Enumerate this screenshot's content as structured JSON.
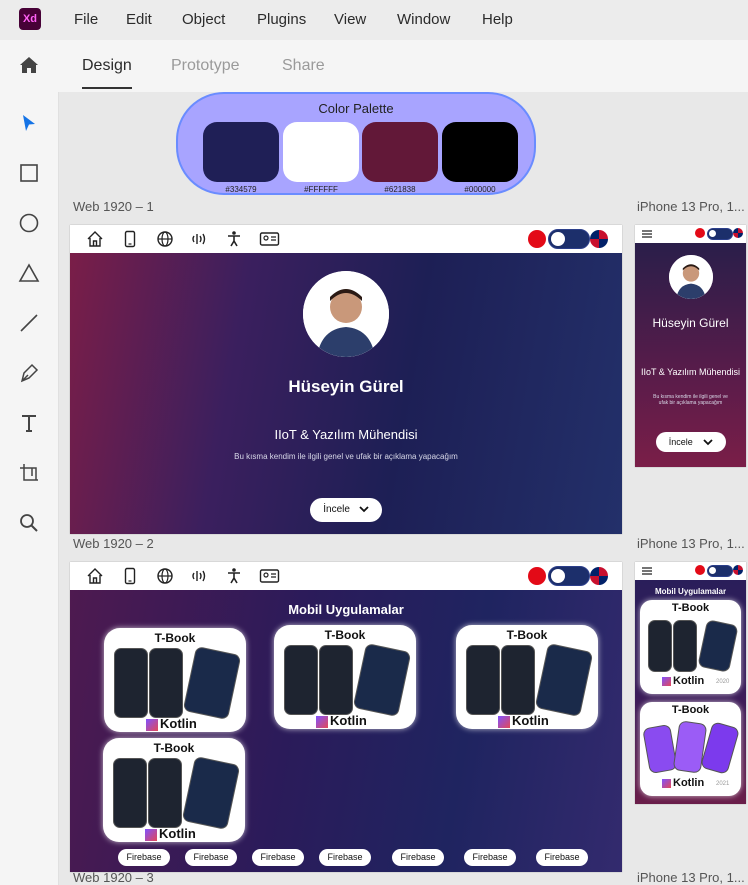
{
  "app": {
    "logo_text": "Xd"
  },
  "menu": [
    "File",
    "Edit",
    "Object",
    "Plugins",
    "View",
    "Window",
    "Help"
  ],
  "tabs": [
    "Design",
    "Prototype",
    "Share"
  ],
  "active_tab": "Design",
  "tools": [
    "select-icon",
    "rectangle-icon",
    "ellipse-icon",
    "polygon-icon",
    "line-icon",
    "pen-icon",
    "text-icon",
    "artboard-icon",
    "zoom-icon"
  ],
  "palette": {
    "title": "Color Palette",
    "colors": [
      {
        "hex": "#334579",
        "label": "#334579",
        "swatch": "#1f1f56"
      },
      {
        "hex": "#FFFFFF",
        "label": "#FFFFFF",
        "swatch": "#ffffff"
      },
      {
        "hex": "#621838",
        "label": "#621838",
        "swatch": "#621838"
      },
      {
        "hex": "#000000",
        "label": "#000000",
        "swatch": "#000000"
      }
    ]
  },
  "artboards": {
    "web1_label": "Web 1920 – 1",
    "web2_label": "Web 1920 – 2",
    "web3_label": "Web 1920 – 3",
    "iphone1_label": "iPhone 13 Pro, 1...",
    "iphone2_label": "iPhone 13 Pro, 1...",
    "iphone3_label": "iPhone 13 Pro, 1..."
  },
  "hero": {
    "name": "Hüseyin Gürel",
    "role": "IIoT & Yazılım Mühendisi",
    "description": "Bu kısma kendim ile ilgili genel ve ufak bir açıklama yapacağım",
    "button": "İncele"
  },
  "mobile_hero": {
    "name": "Hüseyin Gürel",
    "role": "IIoT & Yazılım Mühendisi",
    "description": "Bu kısma kendim ile ilgili genel ve ufak bir açıklama yapacağım",
    "button": "İncele"
  },
  "apps_section": {
    "title": "Mobil Uygulamalar",
    "cards": [
      {
        "title": "T-Book",
        "tech": "Kotlin"
      },
      {
        "title": "T-Book",
        "tech": "Kotlin"
      },
      {
        "title": "T-Book",
        "tech": "Kotlin"
      },
      {
        "title": "T-Book",
        "tech": "Kotlin"
      }
    ],
    "pills": [
      "Firebase",
      "Firebase",
      "Firebase",
      "Firebase",
      "Firebase",
      "Firebase",
      "Firebase"
    ]
  },
  "mobile_apps": {
    "title": "Mobil Uygulamalar",
    "cards": [
      {
        "title": "T-Book",
        "tech": "Kotlin",
        "year": "2020"
      },
      {
        "title": "T-Book",
        "tech": "Kotlin",
        "year": "2021"
      }
    ]
  }
}
